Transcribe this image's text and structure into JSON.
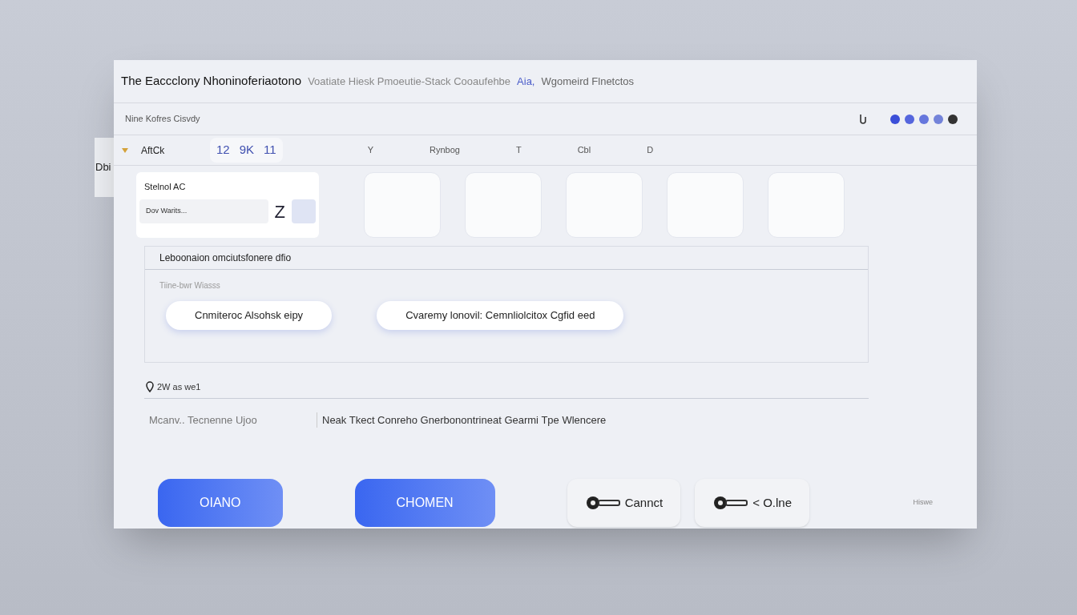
{
  "window": {
    "title": "The  Eaccclony Nhoninoferiaotono",
    "subtitle": "Voatiate Hiesk Pmoeutie-Stack Cooaufehbe",
    "tag": "Aia,",
    "subtitle_end": "Wgomeird Flnetctos"
  },
  "breadcrumb": "Nine Kofres Cisvdy",
  "side_tab": "Dbi",
  "toolbar": {
    "dots": [
      {
        "color": "#3b4fd8"
      },
      {
        "color": "#5566dd"
      },
      {
        "color": "#6677dd"
      },
      {
        "color": "#7383d9"
      },
      {
        "color": "#333333"
      }
    ]
  },
  "group": {
    "label": "AftCk",
    "expanded": true,
    "chips": [
      "12",
      "9K",
      "11"
    ]
  },
  "columns": [
    {
      "label": "Y"
    },
    {
      "label": "Rynbog"
    },
    {
      "label": "T"
    },
    {
      "label": "Cbl"
    },
    {
      "label": "D"
    }
  ],
  "card": {
    "title": "Stelnol AC",
    "field_value": "Dov Warits...",
    "letter": "Z"
  },
  "section": {
    "title": "Leboonaion omciutsfonere dfio",
    "subtitle": "Tiine-bwr Wiasss",
    "pills": [
      "Cnmiteroc Alsohsk eipy",
      "Cvaremy lonovil: Cemnliolcitox Cgfid eed"
    ]
  },
  "location": {
    "label": "2W as we1",
    "cells": [
      "Mcanv.. Tecnenne Ujoo",
      "Neak Tkect Conreho Gnerbonontrineat Gearmi Tpe Wlencere"
    ]
  },
  "buttons": [
    {
      "label": "OIANO",
      "kind": "primary"
    },
    {
      "label": "CHOMEN",
      "kind": "primary"
    },
    {
      "label": "Cannct",
      "kind": "secondary"
    },
    {
      "label": "< O.lne",
      "kind": "secondary"
    }
  ],
  "footer_note": "Hiswe"
}
